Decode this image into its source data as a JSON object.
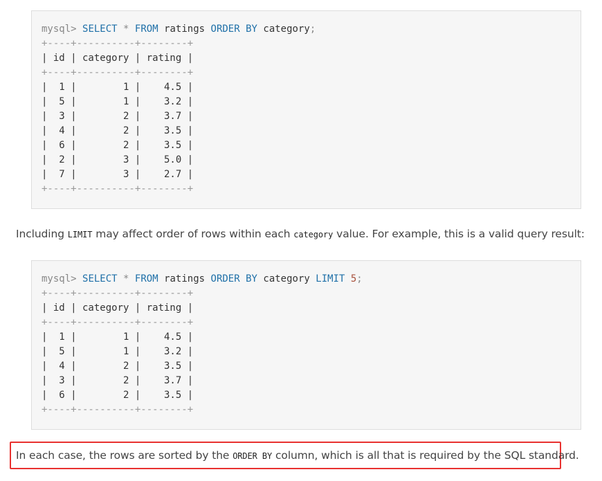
{
  "block1": {
    "prompt": "mysql>",
    "query": {
      "select": "SELECT",
      "star": "*",
      "from": "FROM",
      "table": "ratings",
      "order_by": "ORDER BY",
      "column": "category",
      "terminator": ";"
    },
    "border_line": "+----+----------+--------+",
    "header_line": "| id | category | rating |",
    "rows": [
      "|  1 |        1 |    4.5 |",
      "|  5 |        1 |    3.2 |",
      "|  3 |        2 |    3.7 |",
      "|  4 |        2 |    3.5 |",
      "|  6 |        2 |    3.5 |",
      "|  2 |        3 |    5.0 |",
      "|  7 |        3 |    2.7 |"
    ]
  },
  "paragraph": {
    "before": "Including ",
    "code1": "LIMIT",
    "middle": " may affect order of rows within each ",
    "code2": "category",
    "after": " value. For example, this is a valid query result:"
  },
  "block2": {
    "prompt": "mysql>",
    "query": {
      "select": "SELECT",
      "star": "*",
      "from": "FROM",
      "table": "ratings",
      "order_by": "ORDER BY",
      "column": "category",
      "limit": "LIMIT",
      "limit_value": "5",
      "terminator": ";"
    },
    "border_line": "+----+----------+--------+",
    "header_line": "| id | category | rating |",
    "rows": [
      "|  1 |        1 |    4.5 |",
      "|  5 |        1 |    3.2 |",
      "|  4 |        2 |    3.5 |",
      "|  3 |        2 |    3.7 |",
      "|  6 |        2 |    3.5 |"
    ]
  },
  "note": {
    "before": "In each case, the rows are sorted by the ",
    "code": "ORDER BY",
    "after": " column, which is all that is required by the SQL standard."
  }
}
